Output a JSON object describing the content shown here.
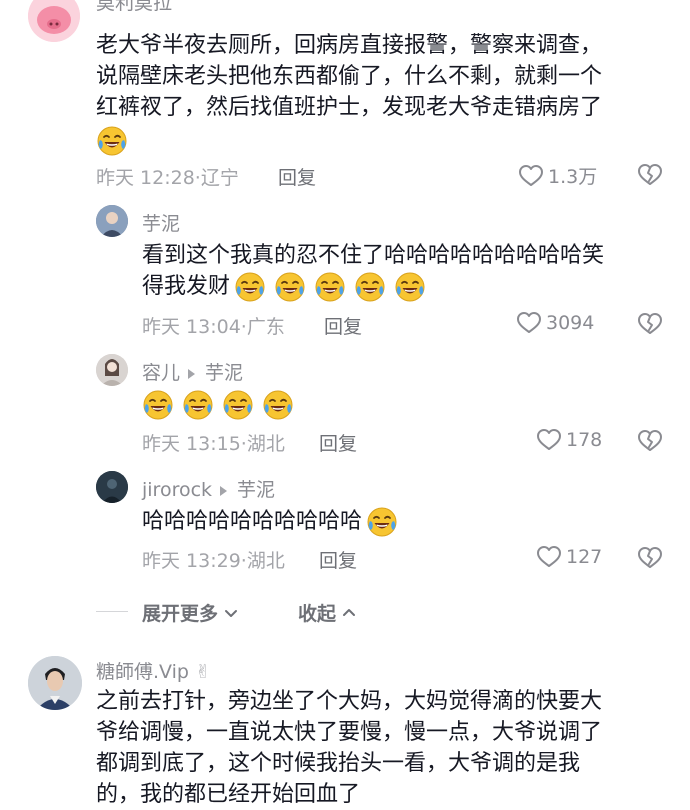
{
  "comments": [
    {
      "id": "c1",
      "author": "莫利莫拉",
      "text_lines": [
        "老大爷半夜去厕所，回病房直接报警，警察来调查，",
        "说隔壁床老头把他东西都偷了，什么不剩，就剩一个",
        "红裤衩了，然后找值班护士，发现老大爷走错病房了"
      ],
      "emoji_count": 1,
      "time": "昨天 12:28",
      "location": "辽宁",
      "reply_label": "回复",
      "likes": "1.3万"
    }
  ],
  "replies": [
    {
      "id": "r1",
      "author": "芋泥",
      "reply_to": "",
      "text_lines": [
        "看到这个我真的忍不住了哈哈哈哈哈哈哈哈哈笑",
        "得我发财"
      ],
      "emoji_count": 5,
      "time": "昨天 13:04",
      "location": "广东",
      "reply_label": "回复",
      "likes": "3094"
    },
    {
      "id": "r2",
      "author": "容儿",
      "reply_to": "芋泥",
      "text_lines": [],
      "emoji_count": 4,
      "time": "昨天 13:15",
      "location": "湖北",
      "reply_label": "回复",
      "likes": "178"
    },
    {
      "id": "r3",
      "author": "jirorock",
      "reply_to": "芋泥",
      "text_lines": [
        "哈哈哈哈哈哈哈哈哈哈"
      ],
      "emoji_count": 1,
      "time": "昨天 13:29",
      "location": "湖北",
      "reply_label": "回复",
      "likes": "127"
    }
  ],
  "thread_controls": {
    "expand_label": "展开更多",
    "collapse_label": "收起"
  },
  "comment2": {
    "author": "糖師傅.Vip",
    "author_badge": "✌",
    "text_lines": [
      "之前去打针，旁边坐了个大妈，大妈觉得滴的快要大",
      "爷给调慢，一直说太快了要慢，慢一点，大爷说调了",
      "都调到底了，这个时候我抬头一看，大爷调的是我",
      "的，我的都已经开始回血了"
    ]
  },
  "colors": {
    "text_primary": "#161823",
    "text_secondary": "#8a8b91",
    "emoji_yellow": "#f7c531",
    "emoji_tears": "#4ea3e8"
  },
  "icons": {
    "like": "heart-outline-icon",
    "dislike": "broken-heart-icon",
    "emoji": "laugh-cry-emoji",
    "expand": "chevron-down-icon",
    "collapse": "chevron-up-icon"
  }
}
